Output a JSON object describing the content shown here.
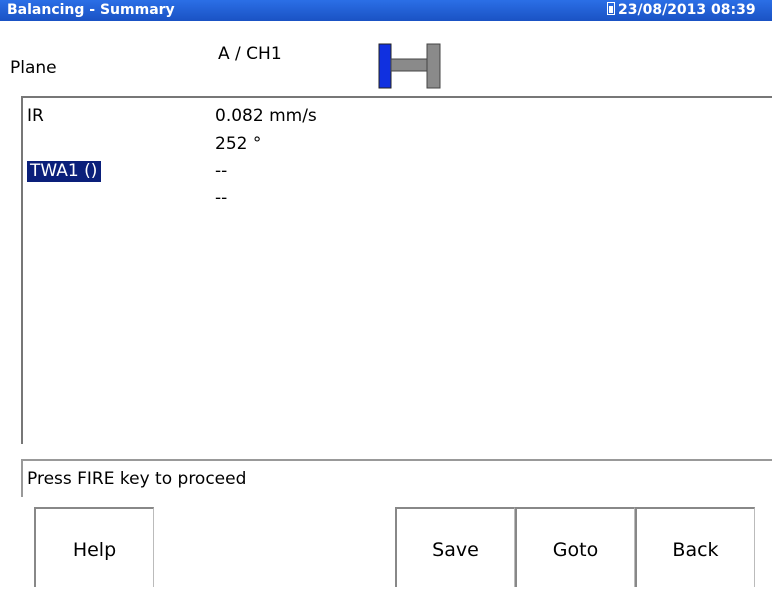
{
  "titlebar": {
    "title": "Balancing - Summary",
    "status": "23/08/2013 08:39",
    "accent": "#1f5fd6"
  },
  "plane": {
    "label": "Plane",
    "value": "A / CH1",
    "icon": "rotor-plane-icon",
    "icon_colors": {
      "active": "#1030e0",
      "shaft": "#808080"
    }
  },
  "results": [
    {
      "label": "IR",
      "values": [
        "0.082 mm/s",
        "252 °"
      ],
      "selected": false
    },
    {
      "label": "TWA1 ()",
      "values": [
        "--",
        "--"
      ],
      "selected": true
    }
  ],
  "status_message": "Press FIRE key to proceed",
  "buttons": {
    "help": "Help",
    "save": "Save",
    "goto": "Goto",
    "back": "Back"
  }
}
